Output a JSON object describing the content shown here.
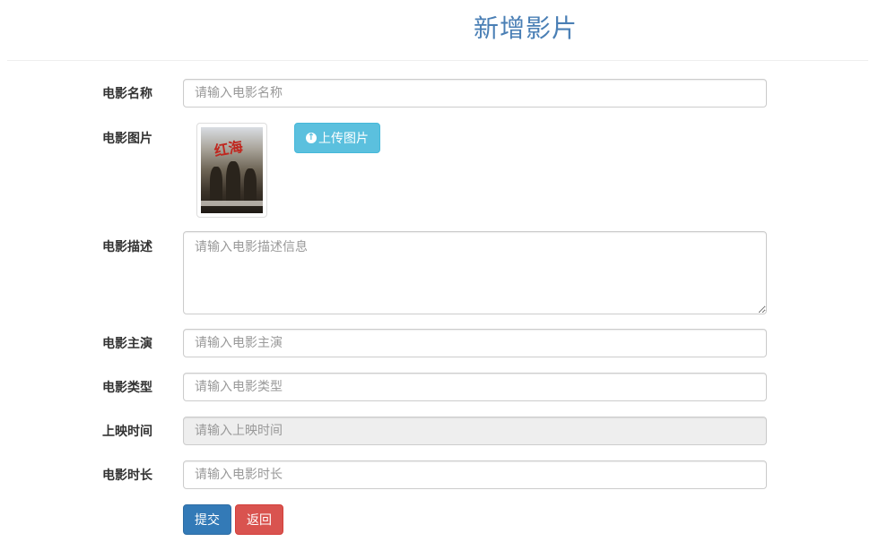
{
  "header": {
    "title": "新增影片"
  },
  "form": {
    "name": {
      "label": "电影名称",
      "placeholder": "请输入电影名称",
      "value": ""
    },
    "image": {
      "label": "电影图片",
      "upload_label": "上传图片",
      "poster_title": "红海"
    },
    "description": {
      "label": "电影描述",
      "placeholder": "请输入电影描述信息",
      "value": ""
    },
    "actors": {
      "label": "电影主演",
      "placeholder": "请输入电影主演",
      "value": ""
    },
    "type": {
      "label": "电影类型",
      "placeholder": "请输入电影类型",
      "value": ""
    },
    "release": {
      "label": "上映时间",
      "placeholder": "请输入上映时间",
      "value": ""
    },
    "duration": {
      "label": "电影时长",
      "placeholder": "请输入电影时长",
      "value": ""
    }
  },
  "actions": {
    "submit_label": "提交",
    "back_label": "返回"
  },
  "colors": {
    "title": "#4a7fb5",
    "upload_button": "#5bc0de",
    "submit_button": "#337ab7",
    "back_button": "#d9534f"
  }
}
